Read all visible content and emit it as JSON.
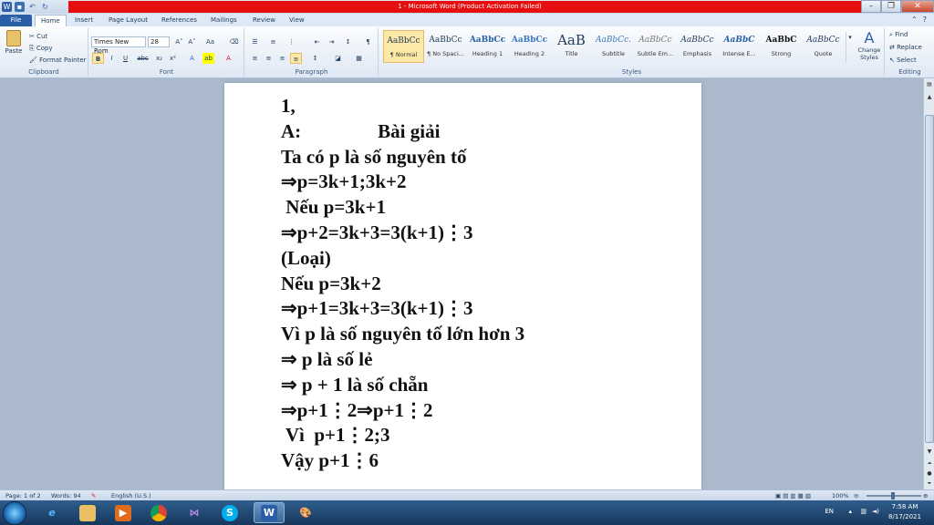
{
  "window": {
    "title": "1 - Microsoft Word (Product Activation Failed)",
    "minimize": "–",
    "maximize": "❐",
    "close": "✕"
  },
  "tabs": [
    "File",
    "Home",
    "Insert",
    "Page Layout",
    "References",
    "Mailings",
    "Review",
    "View"
  ],
  "ribbon": {
    "clipboard": {
      "paste": "Paste",
      "cut": "Cut",
      "copy": "Copy",
      "format_painter": "Format Painter",
      "label": "Clipboard"
    },
    "font": {
      "name": "Times New Rom",
      "size": "28",
      "label": "Font"
    },
    "paragraph": {
      "label": "Paragraph"
    },
    "styles": {
      "items": [
        {
          "preview": "AaBbCc",
          "name": "¶ Normal"
        },
        {
          "preview": "AaBbCc",
          "name": "¶ No Spaci..."
        },
        {
          "preview": "AaBbCc",
          "name": "Heading 1"
        },
        {
          "preview": "AaBbCc",
          "name": "Heading 2"
        },
        {
          "preview": "AaB",
          "name": "Title"
        },
        {
          "preview": "AaBbCc.",
          "name": "Subtitle"
        },
        {
          "preview": "AaBbCc",
          "name": "Subtle Em..."
        },
        {
          "preview": "AaBbCc",
          "name": "Emphasis"
        },
        {
          "preview": "AaBbC",
          "name": "Intense E..."
        },
        {
          "preview": "AaBbC",
          "name": "Strong"
        },
        {
          "preview": "AaBbCc",
          "name": "Quote"
        }
      ],
      "change": "Change Styles",
      "label": "Styles"
    },
    "editing": {
      "find": "Find",
      "replace": "Replace",
      "select": "Select",
      "label": "Editing"
    }
  },
  "document": {
    "lines": [
      "1,",
      "A:                Bài giải",
      "Ta có p là số nguyên tố",
      "⇒p=3k+1;3k+2",
      " Nếu p=3k+1",
      "⇒p+2=3k+3=3(k+1)⋮3",
      "(Loại)",
      "Nếu p=3k+2",
      "⇒p+1=3k+3=3(k+1)⋮3",
      "Vì p là số nguyên tố lớn hơn 3",
      "⇒ p là số lẻ",
      "⇒ p + 1 là số chẵn",
      "⇒p+1⋮2⇒p+1⋮2",
      " Vì  p+1⋮2;3",
      "Vậy p+1⋮6"
    ]
  },
  "status": {
    "page": "Page: 1 of 2",
    "words": "Words: 94",
    "language": "English (U.S.)",
    "zoom": "100%"
  },
  "taskbar": {
    "lang": "EN",
    "time": "7:58 AM",
    "date": "8/17/2021"
  }
}
